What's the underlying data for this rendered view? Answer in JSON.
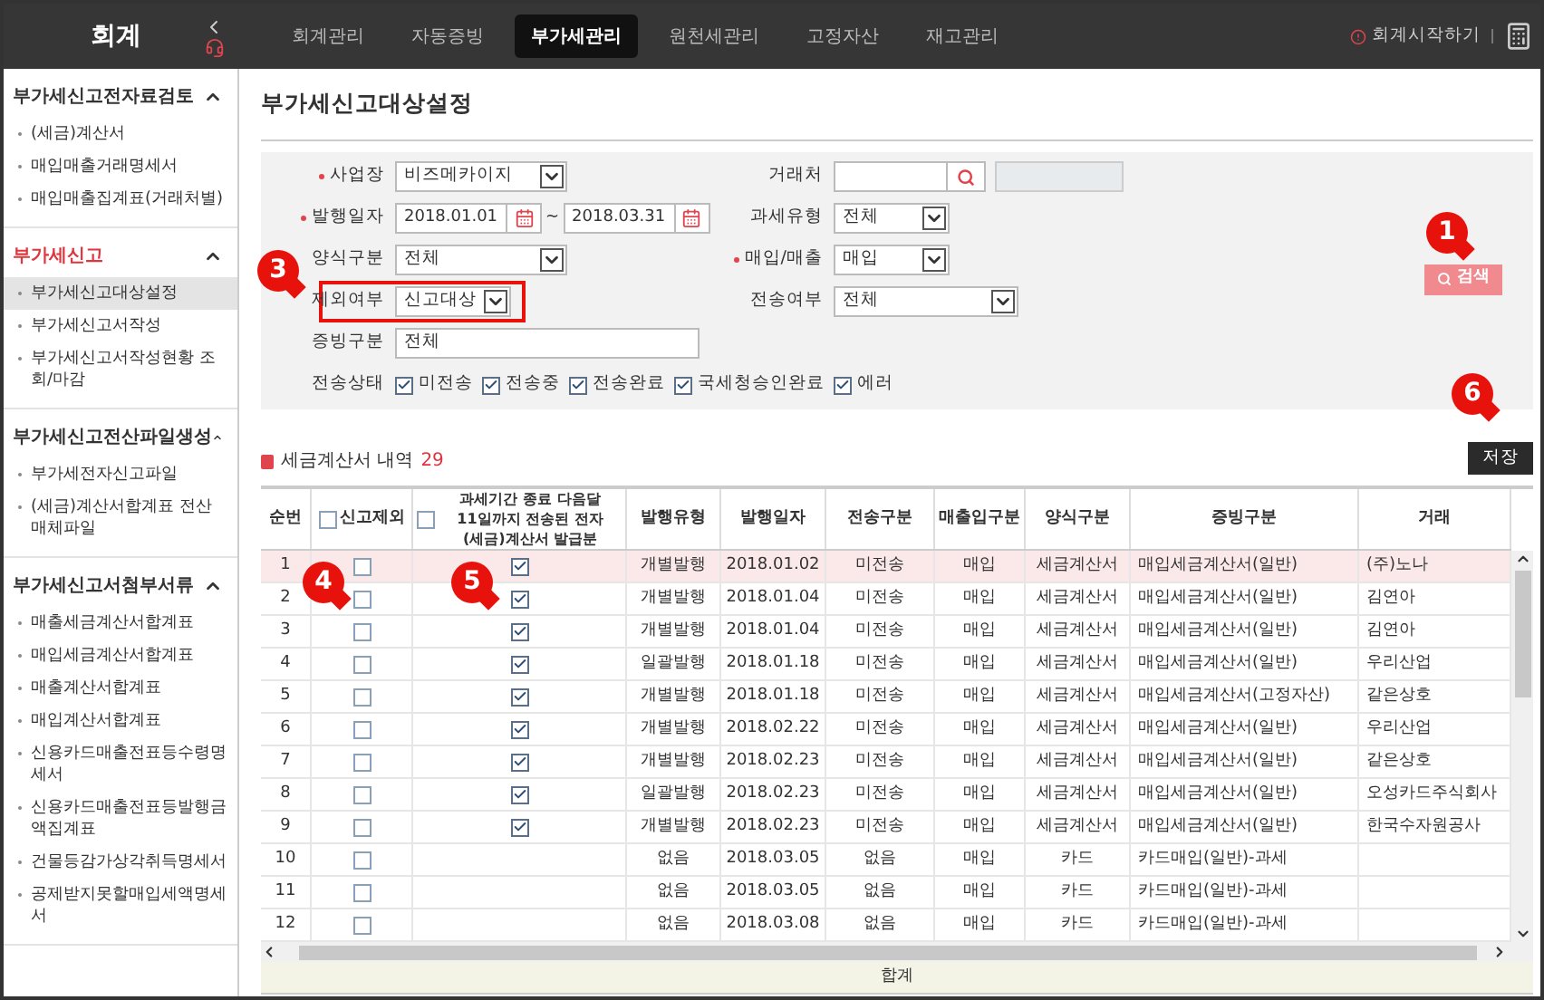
{
  "app": {
    "title": "회계"
  },
  "nav": [
    {
      "label": "회계관리",
      "selected": false
    },
    {
      "label": "자동증빙",
      "selected": false
    },
    {
      "label": "부가세관리",
      "selected": true
    },
    {
      "label": "원천세관리",
      "selected": false
    },
    {
      "label": "고정자산",
      "selected": false
    },
    {
      "label": "재고관리",
      "selected": false
    }
  ],
  "start_link": "회계시작하기",
  "sidebar": [
    {
      "title": "부가세신고전자료검토",
      "active": false,
      "expanded": true,
      "items": [
        {
          "label": "(세금)계산서",
          "selected": false
        },
        {
          "label": "매입매출거래명세서",
          "selected": false
        },
        {
          "label": "매입매출집계표(거래처별)",
          "selected": false
        }
      ]
    },
    {
      "title": "부가세신고",
      "active": true,
      "expanded": true,
      "items": [
        {
          "label": "부가세신고대상설정",
          "selected": true
        },
        {
          "label": "부가세신고서작성",
          "selected": false
        },
        {
          "label": "부가세신고서작성현황 조회/마감",
          "selected": false
        }
      ]
    },
    {
      "title": "부가세신고전산파일생성",
      "active": false,
      "expanded": true,
      "items": [
        {
          "label": "부가세전자신고파일",
          "selected": false
        },
        {
          "label": "(세금)계산서합계표 전산매체파일",
          "selected": false
        }
      ]
    },
    {
      "title": "부가세신고서첨부서류",
      "active": false,
      "expanded": true,
      "items": [
        {
          "label": "매출세금계산서합계표",
          "selected": false
        },
        {
          "label": "매입세금계산서합계표",
          "selected": false
        },
        {
          "label": "매출계산서합계표",
          "selected": false
        },
        {
          "label": "매입계산서합계표",
          "selected": false
        },
        {
          "label": "신용카드매출전표등수령명세서",
          "selected": false
        },
        {
          "label": "신용카드매출전표등발행금액집계표",
          "selected": false
        },
        {
          "label": "건물등감가상각취득명세서",
          "selected": false
        },
        {
          "label": "공제받지못할매입세액명세서",
          "selected": false
        }
      ]
    }
  ],
  "page_title": "부가세신고대상설정",
  "filters": [
    [
      {
        "kind": "select",
        "label": "사업장",
        "required": true,
        "value": "비즈메카이지"
      },
      {
        "kind": "search",
        "label": "거래처"
      }
    ],
    [
      {
        "kind": "daterange",
        "label": "발행일자",
        "required": true,
        "from": "2018.01.01",
        "separator": "~",
        "to": "2018.03.31"
      },
      {
        "kind": "select",
        "label": "과세유형",
        "value": "전체"
      }
    ],
    [
      {
        "kind": "select",
        "label": "양식구분",
        "value": "전체"
      },
      {
        "kind": "select",
        "label": "매입/매출",
        "required": true,
        "value": "매입"
      }
    ],
    [
      {
        "kind": "select",
        "label": "제외여부",
        "value": "신고대상",
        "highlighted": true,
        "callout": "3"
      },
      {
        "kind": "select",
        "label": "전송여부",
        "value": "전체"
      }
    ],
    [
      {
        "kind": "text",
        "label": "증빙구분",
        "value": "전체"
      }
    ],
    [
      {
        "kind": "checkgroup",
        "label": "전송상태",
        "options": [
          {
            "label": "미전송",
            "checked": true
          },
          {
            "label": "전송중",
            "checked": true
          },
          {
            "label": "전송완료",
            "checked": true
          },
          {
            "label": "국세청승인완료",
            "checked": true
          },
          {
            "label": "에러",
            "checked": true
          }
        ]
      }
    ]
  ],
  "search_button": {
    "label": "검색",
    "callout": "1"
  },
  "section": {
    "title": "세금계산서 내역",
    "count": "29"
  },
  "save_button": {
    "label": "저장",
    "callout": "6"
  },
  "table": {
    "columns": [
      {
        "label": "순번"
      },
      {
        "label": "신고제외",
        "checked": false,
        "callout": "4"
      },
      {
        "label": "과세기간 종료 다음달 11일까지 전송된 전자(세금)계산서 발급분",
        "checked": false,
        "callout": "5"
      },
      {
        "label": "발행유형"
      },
      {
        "label": "발행일자"
      },
      {
        "label": "전송구분"
      },
      {
        "label": "매출입구분"
      },
      {
        "label": "양식구분"
      },
      {
        "label": "증빙구분"
      },
      {
        "label": "거래"
      }
    ],
    "rows": [
      {
        "no": "1",
        "excluded": false,
        "period_checked": true,
        "type": "개별발행",
        "date": "2018.01.02",
        "send": "미전송",
        "io": "매입",
        "form": "세금계산서",
        "proof": "매입세금계산서(일반)",
        "partner": "(주)노나",
        "selected": true
      },
      {
        "no": "2",
        "excluded": false,
        "period_checked": true,
        "type": "개별발행",
        "date": "2018.01.04",
        "send": "미전송",
        "io": "매입",
        "form": "세금계산서",
        "proof": "매입세금계산서(일반)",
        "partner": "김연아",
        "selected": false
      },
      {
        "no": "3",
        "excluded": false,
        "period_checked": true,
        "type": "개별발행",
        "date": "2018.01.04",
        "send": "미전송",
        "io": "매입",
        "form": "세금계산서",
        "proof": "매입세금계산서(일반)",
        "partner": "김연아",
        "selected": false
      },
      {
        "no": "4",
        "excluded": false,
        "period_checked": true,
        "type": "일괄발행",
        "date": "2018.01.18",
        "send": "미전송",
        "io": "매입",
        "form": "세금계산서",
        "proof": "매입세금계산서(일반)",
        "partner": "우리산업",
        "selected": false
      },
      {
        "no": "5",
        "excluded": false,
        "period_checked": true,
        "type": "개별발행",
        "date": "2018.01.18",
        "send": "미전송",
        "io": "매입",
        "form": "세금계산서",
        "proof": "매입세금계산서(고정자산)",
        "partner": "같은상호",
        "selected": false
      },
      {
        "no": "6",
        "excluded": false,
        "period_checked": true,
        "type": "개별발행",
        "date": "2018.02.22",
        "send": "미전송",
        "io": "매입",
        "form": "세금계산서",
        "proof": "매입세금계산서(일반)",
        "partner": "우리산업",
        "selected": false
      },
      {
        "no": "7",
        "excluded": false,
        "period_checked": true,
        "type": "개별발행",
        "date": "2018.02.23",
        "send": "미전송",
        "io": "매입",
        "form": "세금계산서",
        "proof": "매입세금계산서(일반)",
        "partner": "같은상호",
        "selected": false
      },
      {
        "no": "8",
        "excluded": false,
        "period_checked": true,
        "type": "일괄발행",
        "date": "2018.02.23",
        "send": "미전송",
        "io": "매입",
        "form": "세금계산서",
        "proof": "매입세금계산서(일반)",
        "partner": "오성카드주식회사",
        "selected": false
      },
      {
        "no": "9",
        "excluded": false,
        "period_checked": true,
        "type": "개별발행",
        "date": "2018.02.23",
        "send": "미전송",
        "io": "매입",
        "form": "세금계산서",
        "proof": "매입세금계산서(일반)",
        "partner": "한국수자원공사",
        "selected": false
      },
      {
        "no": "10",
        "excluded": false,
        "type": "없음",
        "date": "2018.03.05",
        "send": "없음",
        "io": "매입",
        "form": "카드",
        "proof": "카드매입(일반)-과세",
        "selected": false
      },
      {
        "no": "11",
        "excluded": false,
        "type": "없음",
        "date": "2018.03.05",
        "send": "없음",
        "io": "매입",
        "form": "카드",
        "proof": "카드매입(일반)-과세",
        "selected": false
      },
      {
        "no": "12",
        "excluded": false,
        "type": "없음",
        "date": "2018.03.08",
        "send": "없음",
        "io": "매입",
        "form": "카드",
        "proof": "카드매입(일반)-과세",
        "selected": false
      }
    ],
    "total_label": "합계"
  }
}
